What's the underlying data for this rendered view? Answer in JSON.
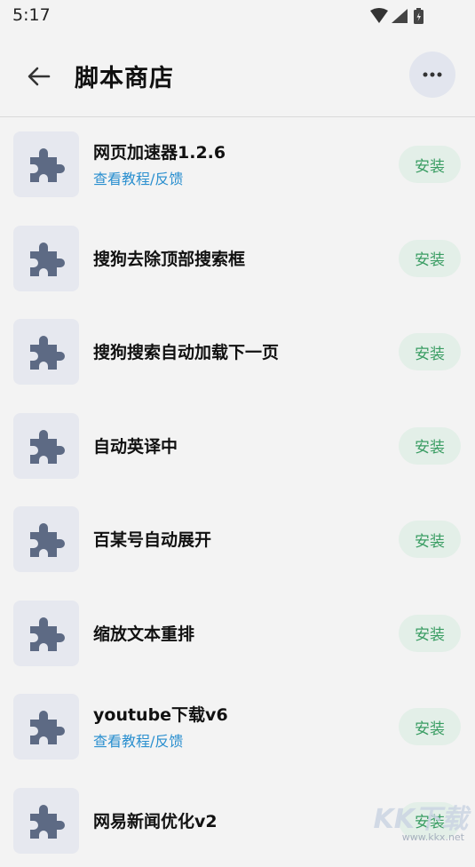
{
  "status_bar": {
    "time": "5:17"
  },
  "header": {
    "title": "脚本商店"
  },
  "install_label": "安装",
  "items": [
    {
      "title": "网页加速器1.2.6",
      "link": "查看教程/反馈"
    },
    {
      "title": "搜狗去除顶部搜索框",
      "link": ""
    },
    {
      "title": "搜狗搜索自动加载下一页",
      "link": ""
    },
    {
      "title": "自动英译中",
      "link": ""
    },
    {
      "title": "百某号自动展开",
      "link": ""
    },
    {
      "title": "缩放文本重排",
      "link": ""
    },
    {
      "title": "youtube下载v6",
      "link": "查看教程/反馈"
    },
    {
      "title": "网易新闻优化v2",
      "link": ""
    }
  ],
  "watermark": {
    "main": "KK下载",
    "sub": "www.kkx.net"
  },
  "colors": {
    "accent_green": "#3a9d63",
    "link_blue": "#2a8fcf",
    "icon_gray": "#5d6a84"
  }
}
